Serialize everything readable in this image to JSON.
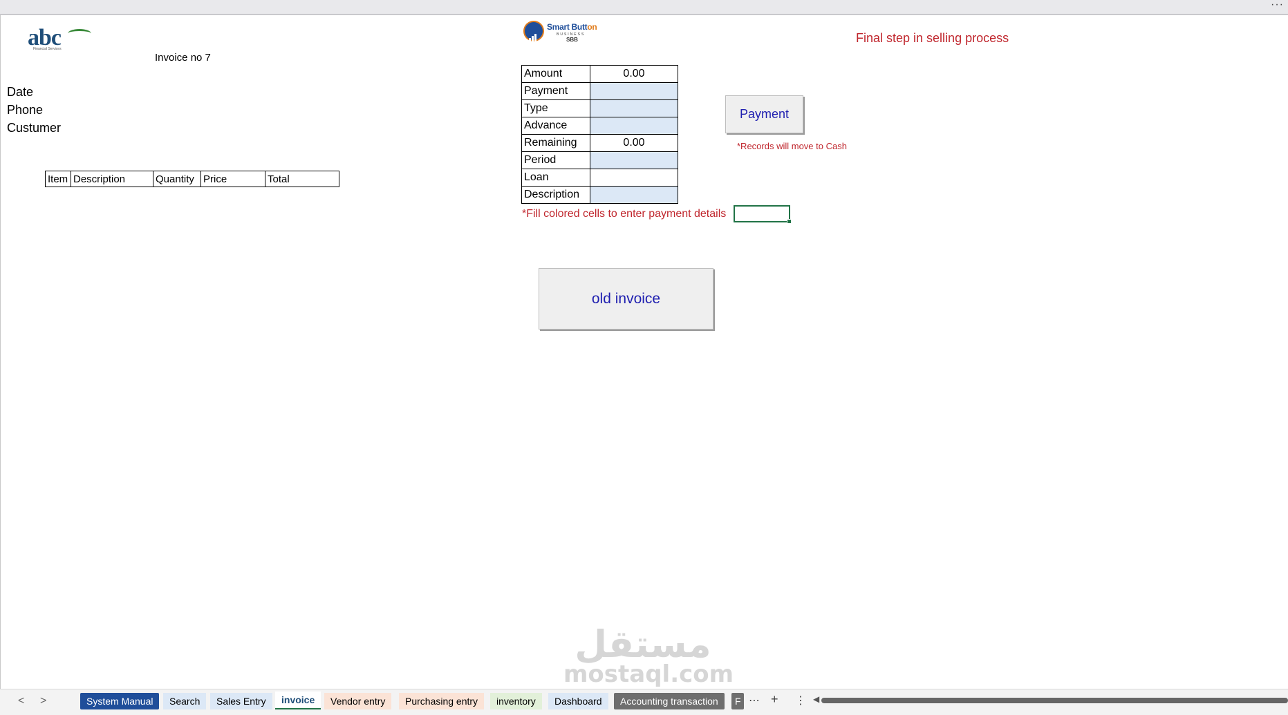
{
  "header": {
    "invoice_no": "Invoice no 7",
    "headline": "Final step in selling process",
    "abc_logo_text": "abc",
    "abc_logo_sub": "Financial Services",
    "sbb_logo": {
      "line1_a": "Smart",
      "line1_b": " Butt",
      "line1_c": "on",
      "line2": "BUSINESS",
      "line3": "SBB"
    }
  },
  "customer_labels": {
    "date": "Date",
    "phone": "Phone",
    "customer": "Custumer"
  },
  "items_table": {
    "headers": [
      "Item",
      "Description",
      "Quantity",
      "Price",
      "Total"
    ]
  },
  "payment_table": {
    "rows": [
      {
        "label": "Amount",
        "value": "0.00",
        "editable": false
      },
      {
        "label": "Payment",
        "value": "",
        "editable": true
      },
      {
        "label": "Type",
        "value": "",
        "editable": true
      },
      {
        "label": "Advance",
        "value": "",
        "editable": true
      },
      {
        "label": "Remaining",
        "value": "0.00",
        "editable": false
      },
      {
        "label": "Period",
        "value": "",
        "editable": true
      },
      {
        "label": "Loan",
        "value": "",
        "editable": false
      },
      {
        "label": "Description",
        "value": "",
        "editable": true
      }
    ]
  },
  "buttons": {
    "payment": "Payment",
    "old_invoice": "old invoice"
  },
  "notes": {
    "records": "*Records will move to Cash",
    "fill": "*Fill colored cells to enter payment details"
  },
  "watermark": {
    "arabic": "مستقل",
    "latin": "mostaql.com"
  },
  "sheet_tabs": {
    "tabs": [
      {
        "label": "System Manual",
        "style": "dark",
        "bg": "#1f4e9a"
      },
      {
        "label": "Search",
        "style": "plain",
        "bg": "#dce8f6"
      },
      {
        "label": "Sales Entry",
        "style": "plain",
        "bg": "#dce8f6"
      },
      {
        "label": "invoice",
        "style": "active",
        "bg": "#ffffff"
      },
      {
        "label": "Vendor entry",
        "style": "plain",
        "bg": "#fbe3d6"
      },
      {
        "label": "Purchasing entry",
        "style": "plain",
        "bg": "#fbe3d6"
      },
      {
        "label": "inventory",
        "style": "plain",
        "bg": "#e2f0d9"
      },
      {
        "label": "Dashboard",
        "style": "plain",
        "bg": "#dce8f6"
      },
      {
        "label": "Accounting transaction",
        "style": "grey",
        "bg": "#6e6e6e"
      },
      {
        "label": "F",
        "style": "grey",
        "bg": "#6e6e6e"
      }
    ],
    "more": "⋯",
    "add": "+",
    "options": "⋮",
    "prev": "<",
    "next": ">"
  },
  "colors": {
    "accent_red": "#c0262d",
    "button_text": "#1f1fb0",
    "input_blue": "#dce8f6",
    "excel_green": "#217346"
  }
}
